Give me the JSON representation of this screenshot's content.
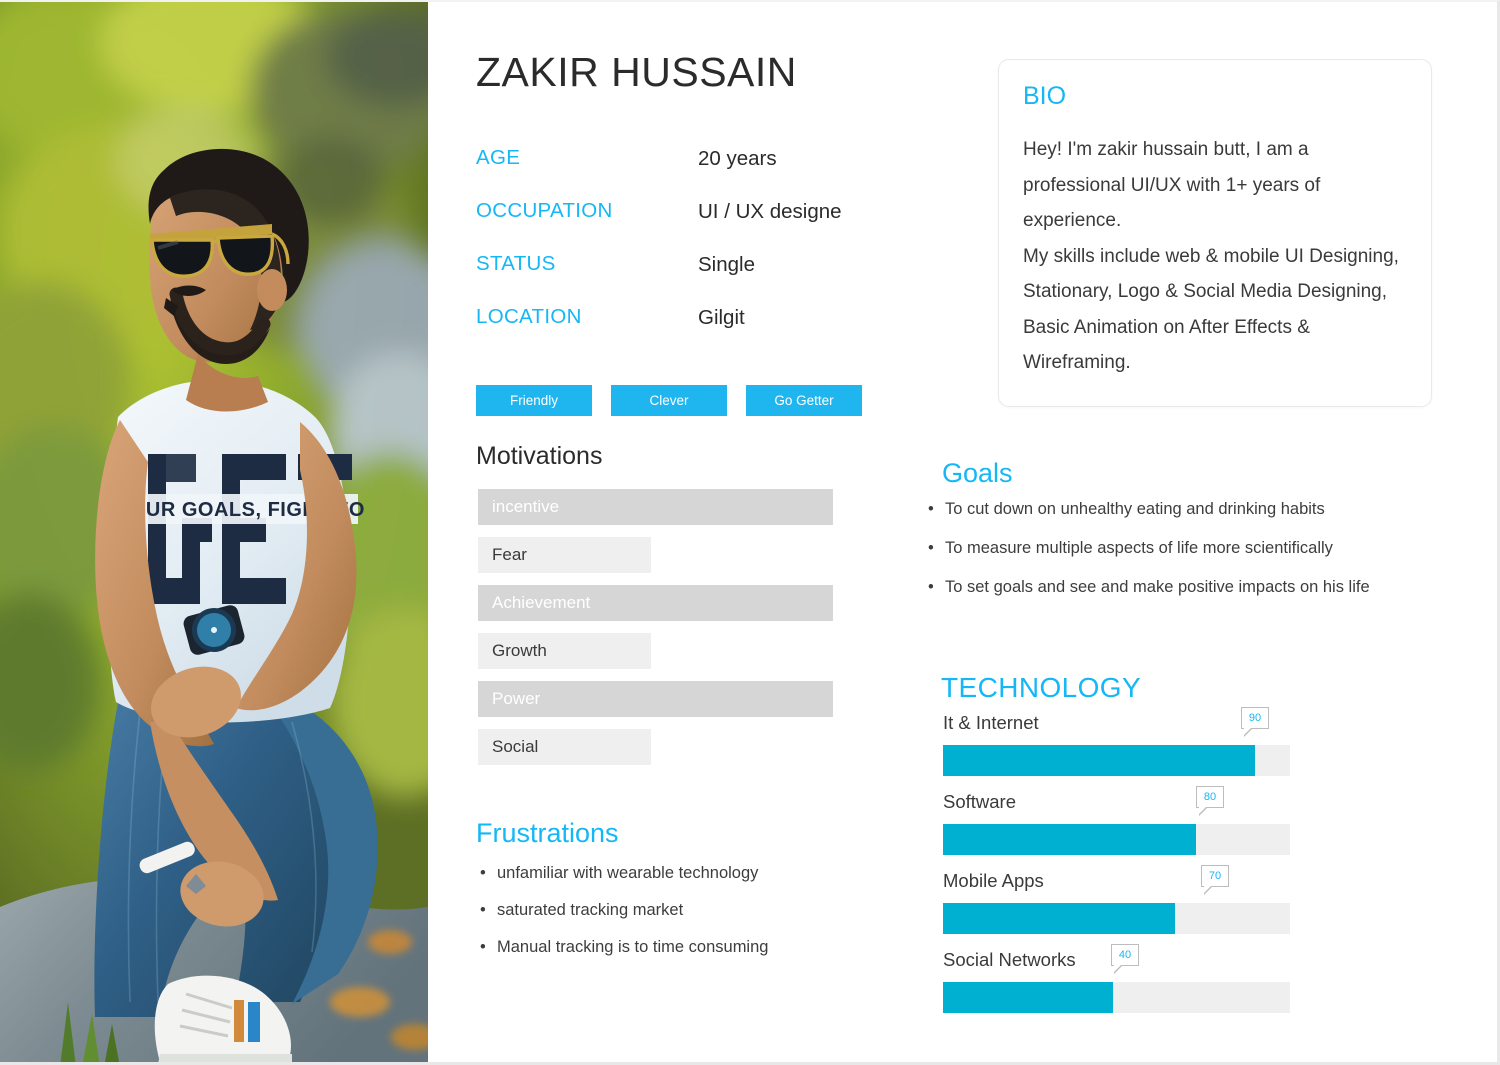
{
  "person": {
    "name": "ZAKIR HUSSAIN",
    "attributes": [
      {
        "label": "AGE",
        "value": "20 years"
      },
      {
        "label": "OCCUPATION",
        "value": "UI / UX designe"
      },
      {
        "label": "STATUS",
        "value": "Single"
      },
      {
        "label": "LOCATION",
        "value": "Gilgit"
      }
    ],
    "tags": [
      "Friendly",
      "Clever",
      "Go Getter"
    ]
  },
  "photo": {
    "alt": "Young man with sunglasses sitting on a mossy rock outdoors",
    "shirt_text_line1": "GET",
    "shirt_text_line2": "YOUR GOALS, FIGHT FOR"
  },
  "motivations": {
    "title": "Motivations",
    "items": [
      {
        "label": "incentive",
        "level": 100,
        "style": "wide"
      },
      {
        "label": "Fear",
        "level": 47,
        "style": "narrow"
      },
      {
        "label": "Achievement",
        "level": 100,
        "style": "wide"
      },
      {
        "label": "Growth",
        "level": 47,
        "style": "narrow"
      },
      {
        "label": "Power",
        "level": 100,
        "style": "wide"
      },
      {
        "label": "Social",
        "level": 47,
        "style": "narrow"
      }
    ]
  },
  "frustrations": {
    "title": "Frustrations",
    "bullet": "•",
    "items": [
      "unfamiliar with wearable technology",
      "saturated tracking market",
      "Manual tracking is to time consuming"
    ]
  },
  "bio": {
    "title": "BIO",
    "text": "Hey! I'm zakir hussain butt, I am a professional UI/UX with 1+ years of experience.\nMy skills include web & mobile UI Designing, Stationary, Logo & Social Media Designing, Basic Animation on After Effects & Wireframing."
  },
  "goals": {
    "title": "Goals",
    "bullet": "•",
    "items": [
      "To cut down on unhealthy eating and drinking habits",
      "To measure multiple aspects of life more scientifically",
      "To set goals and see and make positive impacts on his life"
    ]
  },
  "technology": {
    "title": "TECHNOLOGY",
    "items": [
      {
        "label": "It & Internet",
        "value": 90
      },
      {
        "label": "Software",
        "value": 80
      },
      {
        "label": "Mobile Apps",
        "value": 70
      },
      {
        "label": "Social Networks",
        "value": 40
      }
    ]
  },
  "colors": {
    "accent": "#15b7f5",
    "tag_bg": "#1fb6ef",
    "bar_fill": "#00b0d0",
    "bar_track": "#efefef",
    "motivation_wide": "#d6d6d6",
    "motivation_narrow": "#efefef",
    "text": "#3a3a3a"
  }
}
